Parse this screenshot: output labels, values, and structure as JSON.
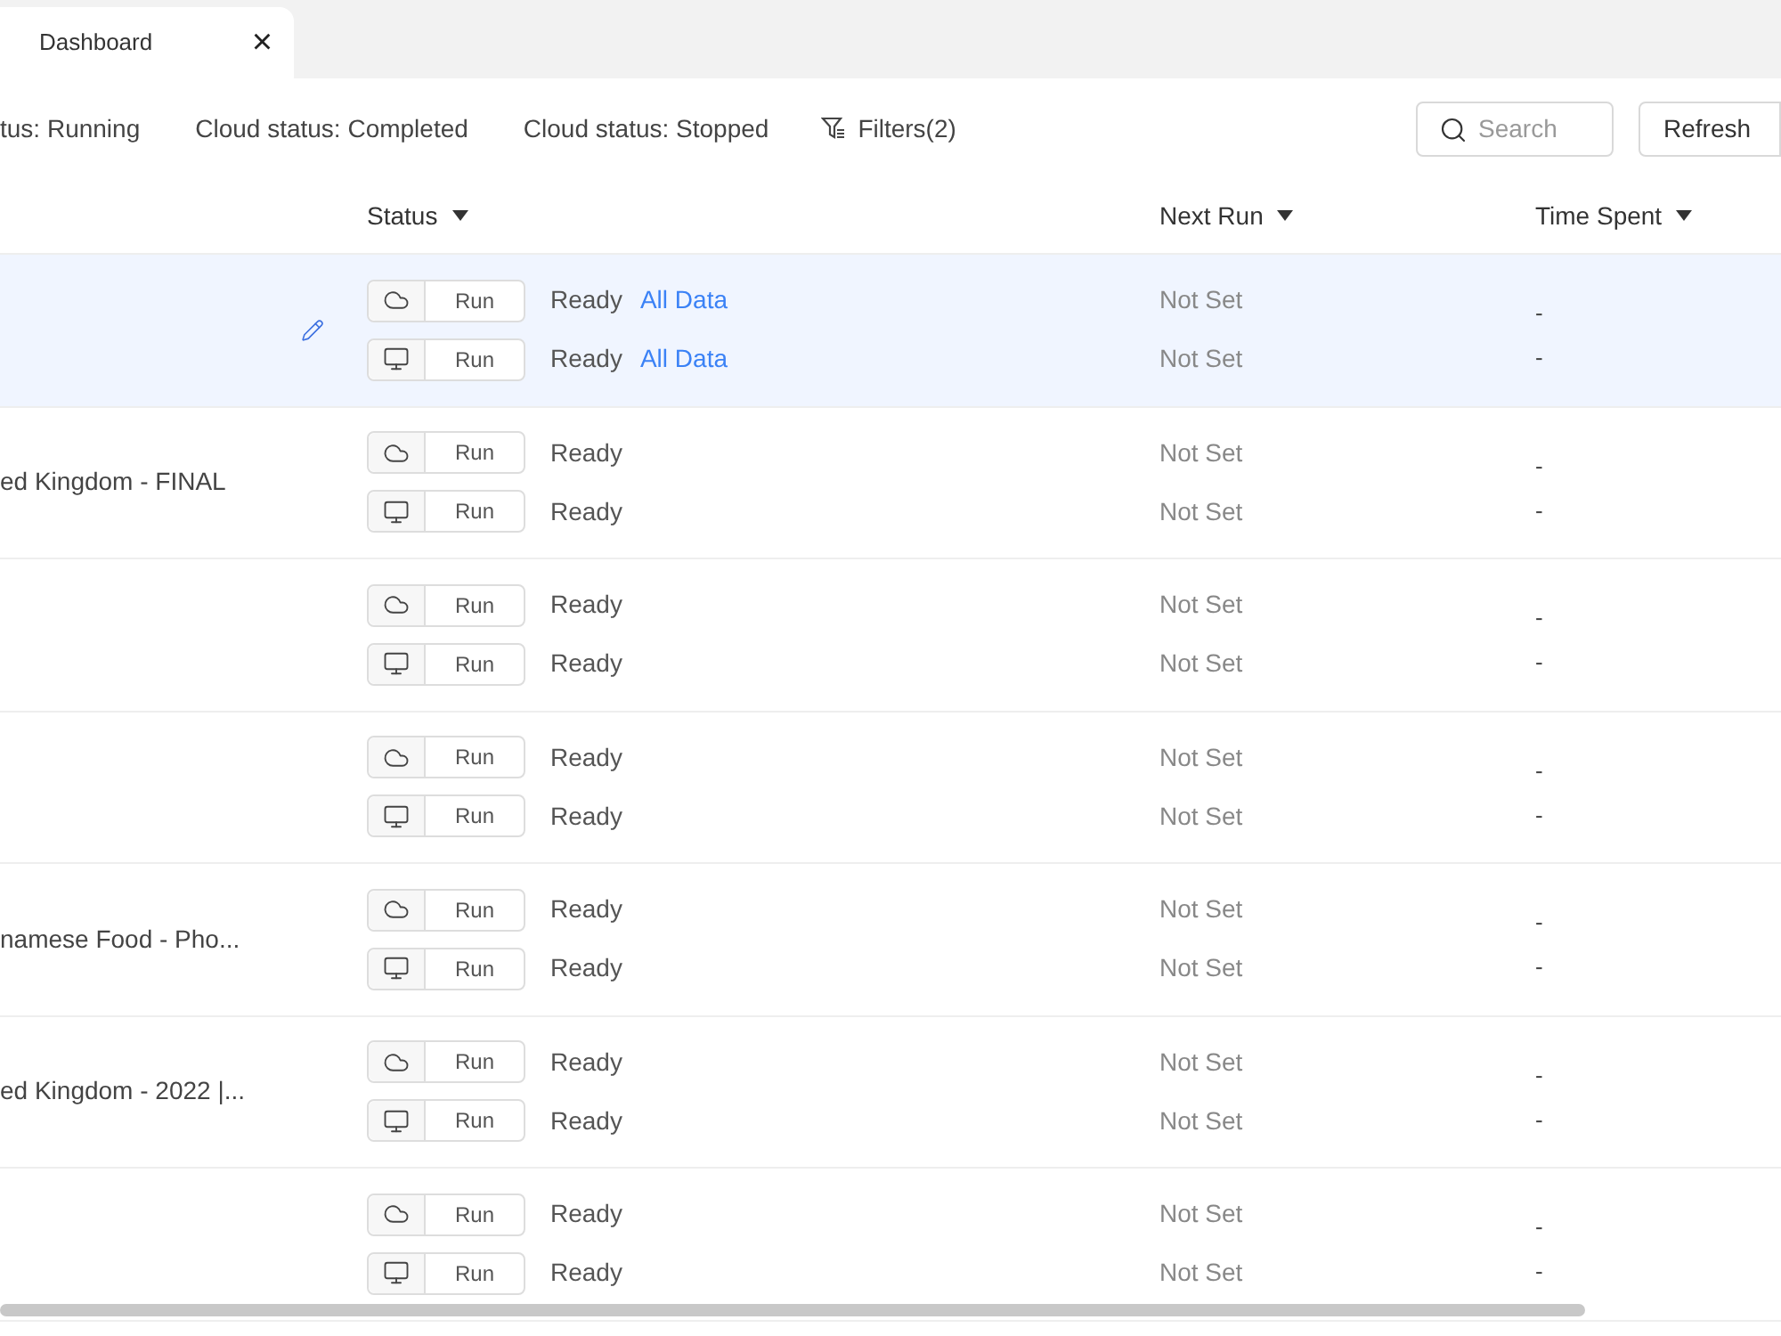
{
  "tabs": [
    {
      "label": "Dashboard",
      "selected": true,
      "close": "×"
    }
  ],
  "filters": [
    "tus: Running",
    "Cloud status: Completed",
    "Cloud status: Stopped"
  ],
  "filters_button": "Filters(2)",
  "search": {
    "placeholder": "Search"
  },
  "refresh_button": "Refresh",
  "table": {
    "columns": [
      {
        "label": "Status"
      },
      {
        "label": "Next Run"
      },
      {
        "label": "Time Spent"
      }
    ],
    "rows": [
      {
        "name": "",
        "selected": true,
        "editable": true,
        "runs": [
          {
            "kind": "cloud",
            "button": "Run",
            "status": "Ready",
            "link": "All Data",
            "next_run": "Not Set",
            "time_spent": "-"
          },
          {
            "kind": "desktop",
            "button": "Run",
            "status": "Ready",
            "link": "All Data",
            "next_run": "Not Set",
            "time_spent": "-"
          }
        ]
      },
      {
        "name": "ed Kingdom - FINAL",
        "selected": false,
        "editable": false,
        "runs": [
          {
            "kind": "cloud",
            "button": "Run",
            "status": "Ready",
            "next_run": "Not Set",
            "time_spent": "-"
          },
          {
            "kind": "desktop",
            "button": "Run",
            "status": "Ready",
            "next_run": "Not Set",
            "time_spent": "-"
          }
        ]
      },
      {
        "name": "",
        "selected": false,
        "editable": false,
        "runs": [
          {
            "kind": "cloud",
            "button": "Run",
            "status": "Ready",
            "next_run": "Not Set",
            "time_spent": "-"
          },
          {
            "kind": "desktop",
            "button": "Run",
            "status": "Ready",
            "next_run": "Not Set",
            "time_spent": "-"
          }
        ]
      },
      {
        "name": "",
        "selected": false,
        "editable": false,
        "runs": [
          {
            "kind": "cloud",
            "button": "Run",
            "status": "Ready",
            "next_run": "Not Set",
            "time_spent": "-"
          },
          {
            "kind": "desktop",
            "button": "Run",
            "status": "Ready",
            "next_run": "Not Set",
            "time_spent": "-"
          }
        ]
      },
      {
        "name": "namese Food - Pho...",
        "selected": false,
        "editable": false,
        "runs": [
          {
            "kind": "cloud",
            "button": "Run",
            "status": "Ready",
            "next_run": "Not Set",
            "time_spent": "-"
          },
          {
            "kind": "desktop",
            "button": "Run",
            "status": "Ready",
            "next_run": "Not Set",
            "time_spent": "-"
          }
        ]
      },
      {
        "name": "ed Kingdom - 2022 |...",
        "selected": false,
        "editable": false,
        "runs": [
          {
            "kind": "cloud",
            "button": "Run",
            "status": "Ready",
            "next_run": "Not Set",
            "time_spent": "-"
          },
          {
            "kind": "desktop",
            "button": "Run",
            "status": "Ready",
            "next_run": "Not Set",
            "time_spent": "-"
          }
        ]
      },
      {
        "name": "",
        "selected": false,
        "editable": false,
        "runs": [
          {
            "kind": "cloud",
            "button": "Run",
            "status": "Ready",
            "next_run": "Not Set",
            "time_spent": "-"
          },
          {
            "kind": "desktop",
            "button": "Run",
            "status": "Ready",
            "next_run": "Not Set",
            "time_spent": "-"
          }
        ]
      }
    ]
  }
}
